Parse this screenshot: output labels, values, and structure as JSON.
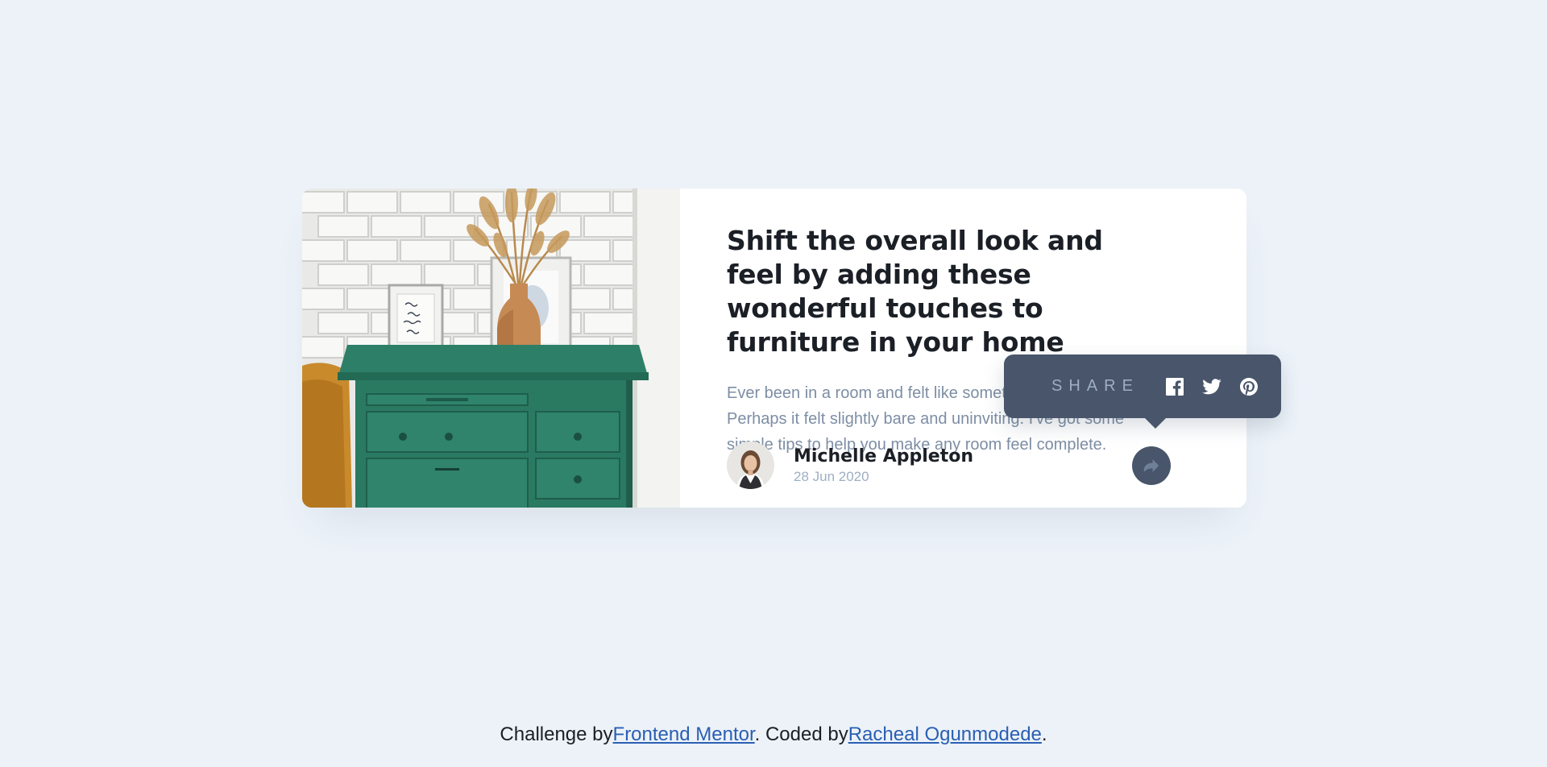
{
  "article": {
    "title": "Shift the overall look and feel by adding these wonderful touches to furniture in your home",
    "excerpt": "Ever been in a room and felt like something was missing? Perhaps it felt slightly bare and uninviting. I've got some simple tips to help you make any room feel complete."
  },
  "author": {
    "name": "Michelle Appleton",
    "date": "28 Jun 2020"
  },
  "share": {
    "label": "SHARE",
    "icons": [
      "facebook-icon",
      "twitter-icon",
      "pinterest-icon"
    ]
  },
  "attribution": {
    "prefix": "Challenge by",
    "mentor_link": "Frontend Mentor",
    "middle": ". Coded by",
    "author_link": "Racheal Ogunmodede",
    "suffix": "."
  },
  "colors": {
    "background": "#ecf2f8",
    "dark_blue": "#48556a",
    "grayish_blue": "#9eafc2",
    "text": "#1b1f26"
  }
}
